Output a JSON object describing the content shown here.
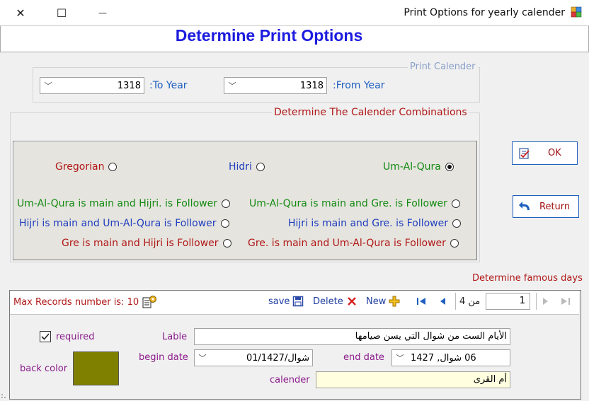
{
  "window": {
    "title": "Print Options for yearly calender",
    "close_glyph": "✕",
    "maximize_glyph": "☐",
    "minimize_glyph": "—"
  },
  "header": {
    "title": "Determine Print Options"
  },
  "print_calender": {
    "legend": "Print Calender",
    "to_year_label": ":To Year",
    "to_year_value": "1318",
    "from_year_label": ":From Year",
    "from_year_value": "1318"
  },
  "combinations": {
    "legend": "Determine The Calender Combinations",
    "options": {
      "gregorian": "Gregorian",
      "hidri": "Hidri",
      "umalqura": "Um-Al-Qura",
      "uaq_main_hijri": "Um-Al-Qura is main and Hijri. is Follower",
      "uaq_main_gre": "Um-Al-Qura is main and Gre. is Follower",
      "hijri_main_uaq": "Hijri is main and Um-Al-Qura is Follower",
      "hijri_main_gre": "Hijri is main and Gre. is Follower",
      "gre_main_hijri": "Gre is main and Hijri is Follower",
      "gre_main_uaq": "Gre. is main and Um-Al-Qura is Follower"
    },
    "selected": "umalqura"
  },
  "buttons": {
    "ok": "OK",
    "return": "Return"
  },
  "famous_days": {
    "title": "Determine famous days",
    "max_records_label": "Max Records number is: 10",
    "save": "save",
    "delete": "Delete",
    "new": "New",
    "total_pages": "من 4",
    "current_page": "1",
    "required_label": "required",
    "required_checked": true,
    "back_color_label": "back color",
    "back_color": "#808000",
    "lable_label": "Lable",
    "lable_value": "الأيام الست من شوال التي يسن صيامها",
    "begin_date_label": "begin date",
    "begin_date_value": "01/شوال/1427",
    "end_date_label": "end date",
    "end_date_value": "06 شوال, 1427",
    "calender_label": "calender",
    "calender_value": "أم القرى"
  },
  "colors": {
    "title_blue": "#1c1ce0",
    "legend_red": "#b01818",
    "field_yellow": "#ffffe0"
  }
}
